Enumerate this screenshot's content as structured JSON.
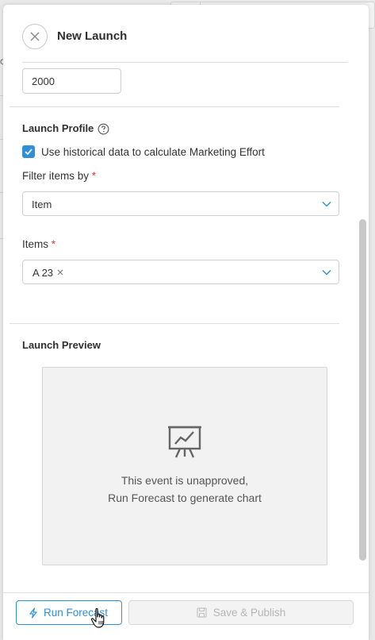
{
  "header": {
    "title": "New Launch"
  },
  "budget": {
    "value": "2000"
  },
  "launch_profile": {
    "title": "Launch Profile",
    "use_historical_label": "Use historical data to calculate Marketing Effort",
    "use_historical_checked": true,
    "filter_label": "Filter items by",
    "filter_value": "Item",
    "items_label": "Items",
    "items_tags": [
      "A 23"
    ],
    "required_mark": "*"
  },
  "launch_preview": {
    "title": "Launch Preview",
    "message_line1": "This event is unapproved,",
    "message_line2": "Run Forecast to generate chart"
  },
  "footer": {
    "run_forecast_label": "Run Forecast",
    "save_publish_label": "Save & Publish"
  },
  "colors": {
    "accent": "#2f8fd8",
    "required": "#e03a3a"
  }
}
